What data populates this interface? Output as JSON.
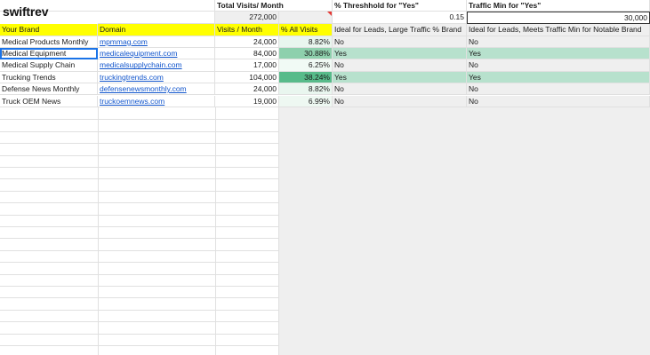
{
  "brand": {
    "logo_text": "swiftrev"
  },
  "summary": {
    "total_visits_label": "Total Visits/ Month",
    "total_visits_value": "272,000",
    "threshold_label": "% Threshhold for \"Yes\"",
    "threshold_value": "0.15",
    "traffic_min_label": "Traffic Min for \"Yes\"",
    "traffic_min_value": "30,000"
  },
  "table": {
    "headers": [
      "Your Brand",
      "Domain",
      "Visits / Month",
      "% All Visits",
      "Ideal for Leads, Large Traffic % Brand",
      "Ideal for Leads, Meets Traffic Min for Notable Brand"
    ],
    "rows": [
      {
        "brand": "Medical Products Monthly",
        "domain": "mpmmag.com",
        "visits": "24,000",
        "pct": "8.82%",
        "ideal_pct": "No",
        "ideal_min": "No",
        "highlight": "none"
      },
      {
        "brand": "Medical Equipment",
        "domain": "medicalequipment.com",
        "visits": "84,000",
        "pct": "30.88%",
        "ideal_pct": "Yes",
        "ideal_min": "Yes",
        "highlight": "green"
      },
      {
        "brand": "Medical Supply Chain",
        "domain": "medicalsupplychain.com",
        "visits": "17,000",
        "pct": "6.25%",
        "ideal_pct": "No",
        "ideal_min": "No",
        "highlight": "none"
      },
      {
        "brand": "Trucking Trends",
        "domain": "truckingtrends.com",
        "visits": "104,000",
        "pct": "38.24%",
        "ideal_pct": "Yes",
        "ideal_min": "Yes",
        "highlight": "green"
      },
      {
        "brand": "Defense News Monthly",
        "domain": "defensenewsmonthly.com",
        "visits": "24,000",
        "pct": "8.82%",
        "ideal_pct": "No",
        "ideal_min": "No",
        "highlight": "none"
      },
      {
        "brand": "Truck OEM News",
        "domain": "truckoemnews.com",
        "visits": "19,000",
        "pct": "6.99%",
        "ideal_pct": "No",
        "ideal_min": "No",
        "highlight": "none"
      }
    ]
  },
  "colors": {
    "header_yellow": "#ffff00",
    "pct_scale_low": "#f4fbf7",
    "pct_scale_high": "#57bb8a",
    "yes_row_green": "#b7e1cd",
    "link": "#1155cc"
  }
}
